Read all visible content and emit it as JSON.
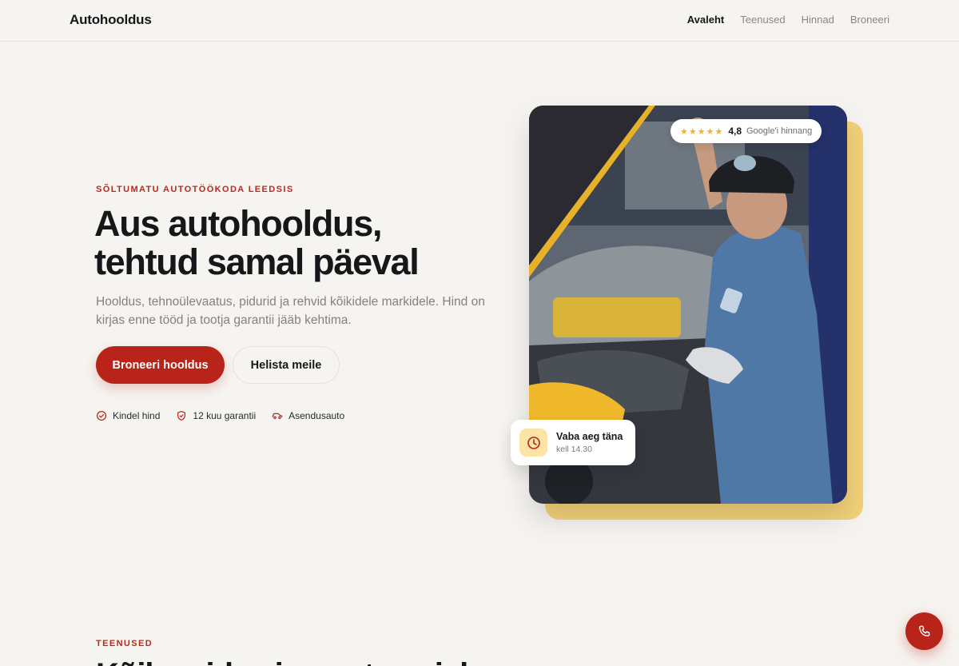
{
  "header": {
    "brand": "Autohooldus",
    "nav": [
      "Avaleht",
      "Teenused",
      "Hinnad",
      "Broneeri"
    ],
    "active_nav": "Avaleht"
  },
  "hero": {
    "eyebrow": "SÕLTUMATU AUTOTÖÖKODA LEEDSIS",
    "headline_line1": "Aus autohooldus,",
    "headline_line2": "tehtud samal päeval",
    "lead": "Hooldus, tehnoülevaatus, pidurid ja rehvid kõikidele markidele. Hind on kirjas enne tööd ja tootja garantii jääb kehtima.",
    "primary_cta": "Broneeri hooldus",
    "secondary_cta": "Helista meile",
    "features": [
      {
        "icon": "check-circle-icon",
        "label": "Kindel hind"
      },
      {
        "icon": "shield-check-icon",
        "label": "12 kuu garantii"
      },
      {
        "icon": "car-icon",
        "label": "Asendusauto"
      }
    ]
  },
  "rating_badge": {
    "stars": "★★★★★",
    "star_count": 5,
    "score": "4,8",
    "label": "Google'i hinnang"
  },
  "availability_card": {
    "icon": "clock-icon",
    "title": "Vaba aeg täna",
    "subtitle": "kell 14.30"
  },
  "services_section": {
    "eyebrow": "TEENUSED",
    "title": "Kõik, mida sinu auto vajab"
  },
  "floating_action": {
    "icon": "phone-icon"
  },
  "colors": {
    "accent": "#b82419",
    "background": "#f6f4f0",
    "highlight": "#f4d27a",
    "text": "#17171a"
  }
}
